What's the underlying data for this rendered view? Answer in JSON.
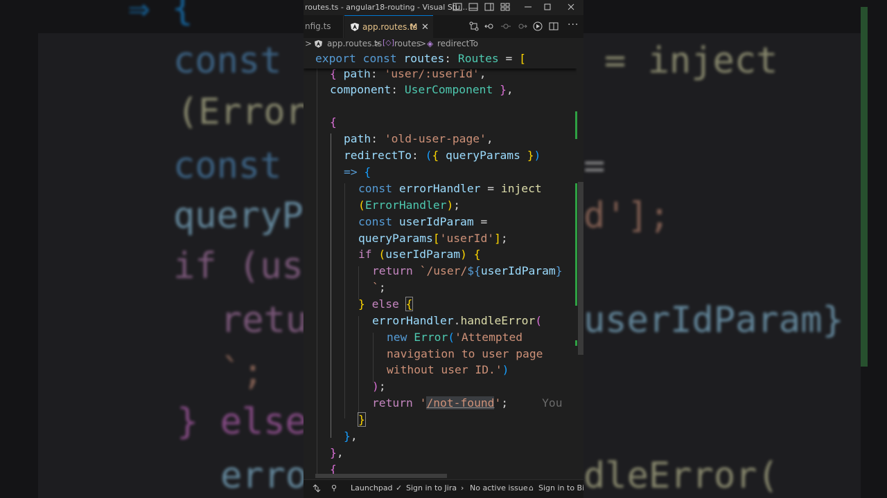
{
  "window": {
    "title": "routes.ts - angular18-routing - Visual Stu..."
  },
  "tabs": [
    {
      "label": "nfig.ts",
      "active": false
    },
    {
      "label": "app.routes.ts",
      "active": true,
      "modified": "M"
    }
  ],
  "breadcrumb": {
    "file": "app.routes.ts",
    "sep": ">",
    "symbol1": "routes",
    "symbol2": "redirectTo"
  },
  "editor": {
    "sticky": [
      "export",
      " ",
      "const",
      " ",
      "routes",
      ": ",
      "Routes",
      " = ",
      "["
    ],
    "lines": [
      [
        "{",
        " ",
        "path",
        ": ",
        "'user/:userId'",
        ","
      ],
      [
        "component",
        ": ",
        "UserComponent",
        " ",
        "}",
        ","
      ],
      [
        ""
      ],
      [
        "{"
      ],
      [
        "path",
        ": ",
        "'old-user-page'",
        ","
      ],
      [
        "redirectTo",
        ": ",
        "(",
        "{",
        " ",
        "queryParams",
        " ",
        "}",
        ")"
      ],
      [
        "=>",
        " ",
        "{"
      ],
      [
        "const",
        " ",
        "errorHandler",
        " = ",
        "inject"
      ],
      [
        "(",
        "ErrorHandler",
        ")",
        ";"
      ],
      [
        "const",
        " ",
        "userIdParam",
        " ="
      ],
      [
        "queryParams",
        "[",
        "'userId'",
        "]",
        ";"
      ],
      [
        "if",
        " ",
        "(",
        "userIdParam",
        ")",
        " ",
        "{"
      ],
      [
        "return",
        " ",
        "`/user/",
        "${",
        "userIdParam",
        "}"
      ],
      [
        "`",
        ";"
      ],
      [
        "}",
        " ",
        "else",
        " ",
        "{"
      ],
      [
        "errorHandler",
        ".",
        "handleError",
        "("
      ],
      [
        "new",
        " ",
        "Error",
        "(",
        "'Attempted"
      ],
      [
        "navigation to user page"
      ],
      [
        "without user ID.'",
        ")"
      ],
      [
        ")",
        ";"
      ],
      [
        "return",
        " ",
        "'",
        "/not-found",
        "'",
        ";",
        "     ",
        "You"
      ],
      [
        "}"
      ],
      [
        "}",
        ","
      ],
      [
        "}",
        ","
      ],
      [
        "{"
      ]
    ]
  },
  "statusbar": {
    "launchpad": "Launchpad",
    "jira": "Sign in to Jira",
    "issue": "No active issue",
    "bitbucket": "Sign in to Bitb"
  },
  "background": {
    "left": [
      "⇒ {",
      "const",
      "(Error",
      "const",
      "queryP",
      "if (us",
      "retu",
      "`;",
      "} else",
      "erro"
    ],
    "right": [
      "= inject",
      "=",
      "d'];",
      "userIdParam}",
      "dleError("
    ]
  },
  "colors": {
    "keyword": "#569cd6",
    "control": "#c586c0",
    "variable": "#9cdcfe",
    "type": "#4ec9b0",
    "string": "#ce9178",
    "function": "#dcdcaa",
    "bracket1": "#ffd700",
    "bracket2": "#da70d6",
    "bracket3": "#179fff",
    "git_added": "#2ea043"
  }
}
